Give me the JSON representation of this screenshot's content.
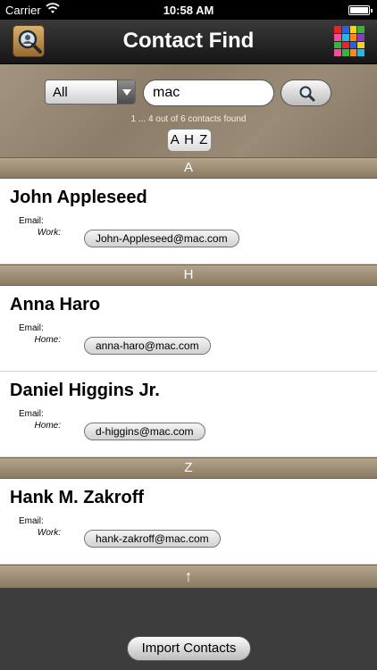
{
  "status_bar": {
    "carrier": "Carrier",
    "time": "10:58 AM"
  },
  "nav": {
    "title": "Contact Find",
    "grid_colors": [
      "#e8242a",
      "#2b60e0",
      "#f7d21a",
      "#37b43c",
      "#f0509a",
      "#2ab5e8",
      "#ff8a1c",
      "#8a3ac8",
      "#37b43c",
      "#e8242a",
      "#2b60e0",
      "#f7d21a",
      "#f0509a",
      "#37b43c",
      "#ff8a1c",
      "#2ab5e8"
    ]
  },
  "search": {
    "filter_value": "All",
    "query": "mac",
    "result_count": "1 ... 4 out of 6 contacts found",
    "index_label": "A H Z"
  },
  "sections": [
    {
      "letter": "A",
      "contacts": [
        {
          "name": "John Appleseed",
          "email_label": "Email:",
          "email_type": "Work:",
          "email": "John-Appleseed@mac.com"
        }
      ]
    },
    {
      "letter": "H",
      "contacts": [
        {
          "name": "Anna Haro",
          "email_label": "Email:",
          "email_type": "Home:",
          "email": "anna-haro@mac.com"
        },
        {
          "name": "Daniel Higgins Jr.",
          "email_label": "Email:",
          "email_type": "Home:",
          "email": "d-higgins@mac.com"
        }
      ]
    },
    {
      "letter": "Z",
      "contacts": [
        {
          "name": "Hank M. Zakroff",
          "email_label": "Email:",
          "email_type": "Work:",
          "email": "hank-zakroff@mac.com"
        }
      ]
    }
  ],
  "scroll_top_symbol": "↑",
  "bottom": {
    "import_label": "Import Contacts"
  }
}
